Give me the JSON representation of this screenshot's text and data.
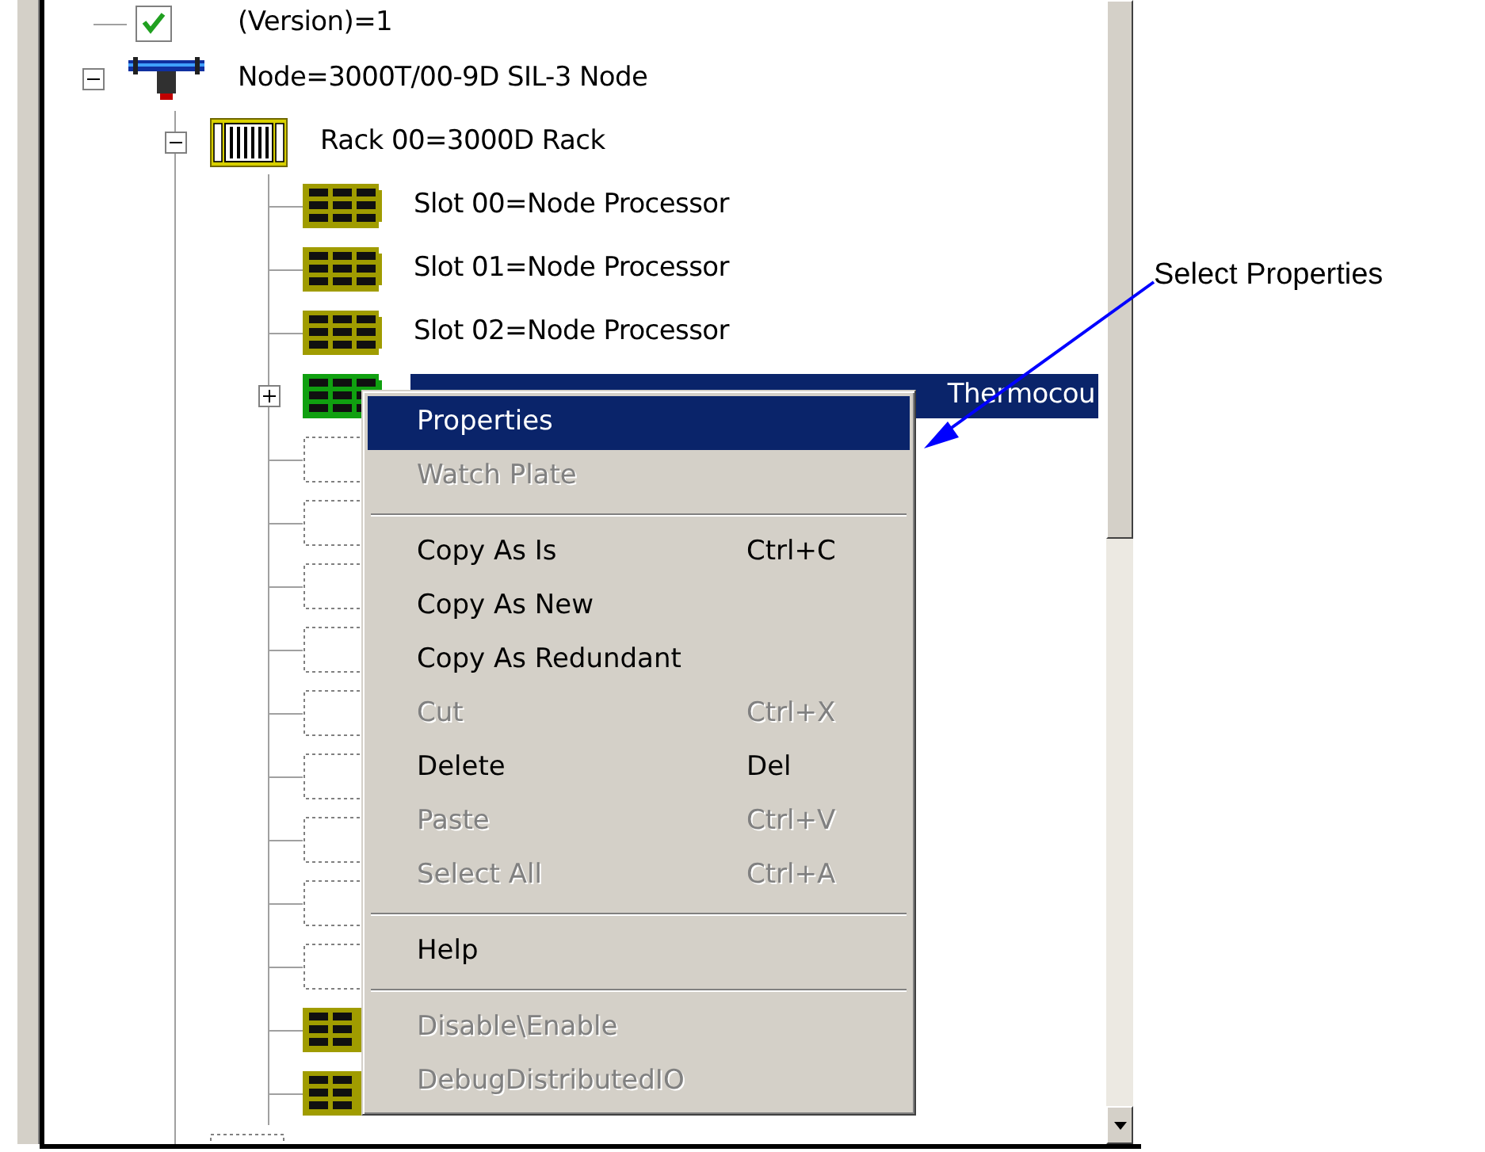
{
  "tree": [
    {
      "label": "(Version)=1",
      "kind": "check"
    },
    {
      "label": "Node=3000T/00-9D SIL-3 Node",
      "kind": "node",
      "expanded": true,
      "children": [
        {
          "label": "Rack 00=3000D Rack",
          "kind": "rack",
          "expanded": true,
          "children": [
            {
              "label": "Slot 00=Node Processor",
              "kind": "card",
              "selected": false
            },
            {
              "label": "Slot 01=Node Processor",
              "kind": "card",
              "selected": false
            },
            {
              "label": "Slot 02=Node Processor",
              "kind": "card",
              "selected": false
            },
            {
              "label": "Thermocou",
              "kind": "card",
              "selected": true,
              "expanded": false
            },
            {
              "kind": "empty"
            },
            {
              "kind": "empty"
            },
            {
              "kind": "empty"
            },
            {
              "kind": "empty"
            },
            {
              "kind": "empty"
            },
            {
              "kind": "empty"
            },
            {
              "kind": "empty"
            },
            {
              "kind": "empty"
            },
            {
              "kind": "empty"
            },
            {
              "kind": "card"
            },
            {
              "kind": "card"
            }
          ]
        },
        {
          "kind": "empty"
        }
      ]
    }
  ],
  "context_menu": [
    {
      "kind": "item",
      "label": "Properties",
      "disabled": false,
      "selected": true
    },
    {
      "kind": "item",
      "label": "Watch Plate",
      "disabled": true,
      "selected": false
    },
    {
      "kind": "separator"
    },
    {
      "kind": "item",
      "label": "Copy As Is",
      "shortcut": "Ctrl+C",
      "disabled": false,
      "selected": false
    },
    {
      "kind": "item",
      "label": "Copy As New",
      "disabled": false,
      "selected": false
    },
    {
      "kind": "item",
      "label": "Copy As Redundant",
      "disabled": false,
      "selected": false
    },
    {
      "kind": "item",
      "label": "Cut",
      "shortcut": "Ctrl+X",
      "disabled": true,
      "selected": false
    },
    {
      "kind": "item",
      "label": "Delete",
      "shortcut": "Del",
      "disabled": false,
      "selected": false
    },
    {
      "kind": "item",
      "label": "Paste",
      "shortcut": "Ctrl+V",
      "disabled": true,
      "selected": false
    },
    {
      "kind": "item",
      "label": "Select All",
      "shortcut": "Ctrl+A",
      "disabled": true,
      "selected": false
    },
    {
      "kind": "separator"
    },
    {
      "kind": "item",
      "label": "Help",
      "disabled": false,
      "selected": false
    },
    {
      "kind": "separator"
    },
    {
      "kind": "item",
      "label": "Disable\\Enable",
      "disabled": true,
      "selected": false
    },
    {
      "kind": "item",
      "label": "DebugDistributedIO",
      "disabled": true,
      "selected": false
    }
  ],
  "callout": {
    "text": "Select Properties"
  }
}
